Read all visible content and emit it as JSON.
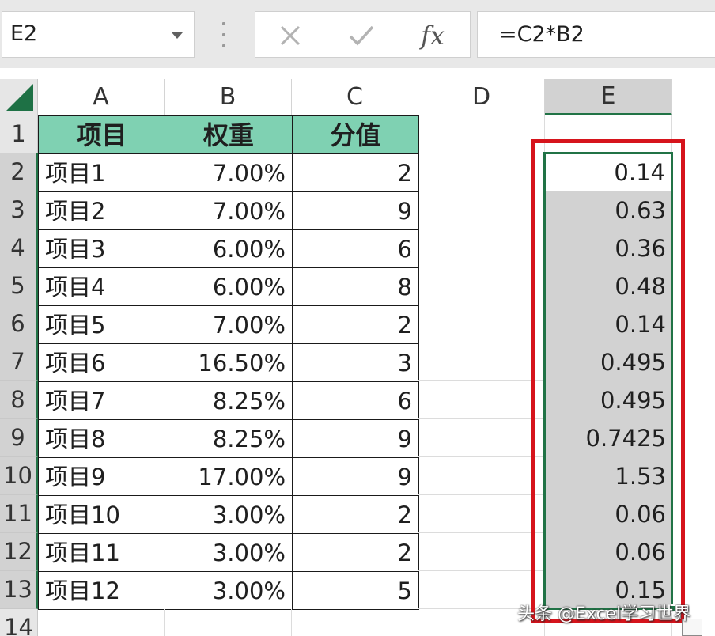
{
  "formula_bar": {
    "name_box": "E2",
    "formula": "=C2*B2",
    "buttons": {
      "cancel": "×",
      "enter": "✓",
      "function": "fx"
    }
  },
  "columns": [
    "A",
    "B",
    "C",
    "D",
    "E"
  ],
  "rows": [
    "1",
    "2",
    "3",
    "4",
    "5",
    "6",
    "7",
    "8",
    "9",
    "10",
    "11",
    "12",
    "13",
    "14"
  ],
  "table_header": [
    "项目",
    "权重",
    "分值"
  ],
  "table_rows": [
    [
      "项目1",
      "7.00%",
      "2"
    ],
    [
      "项目2",
      "7.00%",
      "9"
    ],
    [
      "项目3",
      "6.00%",
      "6"
    ],
    [
      "项目4",
      "6.00%",
      "8"
    ],
    [
      "项目5",
      "7.00%",
      "2"
    ],
    [
      "项目6",
      "16.50%",
      "3"
    ],
    [
      "项目7",
      "8.25%",
      "6"
    ],
    [
      "项目8",
      "8.25%",
      "9"
    ],
    [
      "项目9",
      "17.00%",
      "9"
    ],
    [
      "项目10",
      "3.00%",
      "2"
    ],
    [
      "项目11",
      "3.00%",
      "2"
    ],
    [
      "项目12",
      "3.00%",
      "5"
    ]
  ],
  "column_e": [
    "0.14",
    "0.63",
    "0.36",
    "0.48",
    "0.14",
    "0.495",
    "0.495",
    "0.7425",
    "1.53",
    "0.06",
    "0.06",
    "0.15"
  ],
  "selection": {
    "active_cell": "E2",
    "range": "E2:E13"
  },
  "colors": {
    "header_fill": "#7fd1b2",
    "selection_green": "#217346",
    "highlight_red": "#d6141c"
  },
  "watermark": "头条 @Excel学习世界"
}
